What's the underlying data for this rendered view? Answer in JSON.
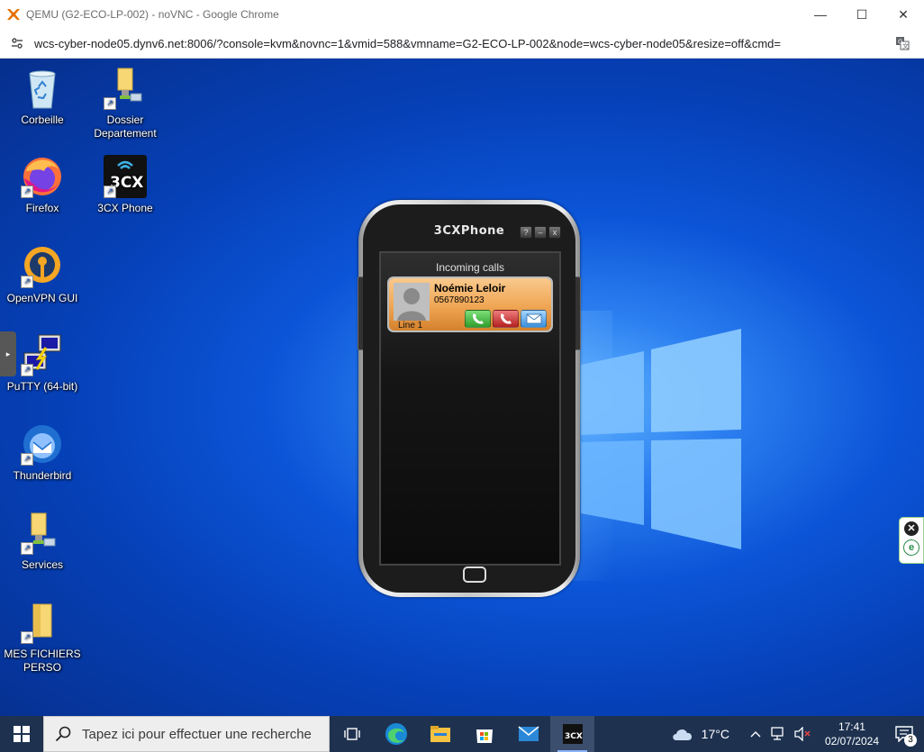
{
  "window": {
    "title": "QEMU (G2-ECO-LP-002) - noVNC - Google Chrome",
    "url": "wcs-cyber-node05.dynv6.net:8006/?console=kvm&novnc=1&vmid=588&vmname=G2-ECO-LP-002&node=wcs-cyber-node05&resize=off&cmd=",
    "controls": {
      "minimize": "—",
      "maximize": "☐",
      "close": "✕"
    }
  },
  "desktop": {
    "icons": [
      {
        "label": "Corbeille"
      },
      {
        "label": "Dossier Departement"
      },
      {
        "label": "Firefox"
      },
      {
        "label": "3CX Phone",
        "glyph": "3CX"
      },
      {
        "label": "OpenVPN GUI"
      },
      {
        "label": "PuTTY (64-bit)"
      },
      {
        "label": "Thunderbird"
      },
      {
        "label": "Services"
      },
      {
        "label": "MES FICHIERS PERSO"
      }
    ],
    "side_handle": "▸"
  },
  "phone": {
    "title": "3CXPhone",
    "buttons": {
      "help": "?",
      "minimize": "–",
      "close": "x"
    },
    "screen_header": "Incoming calls",
    "call": {
      "caller_name": "Noémie Leloir",
      "caller_number": "0567890123",
      "line": "Line 1"
    }
  },
  "taskbar": {
    "search_placeholder": "Tapez ici pour effectuer une recherche",
    "weather": "17°C",
    "time": "17:41",
    "date": "02/07/2024",
    "notification_count": "3"
  },
  "right_widget": {
    "close": "✕",
    "logo": "e"
  }
}
